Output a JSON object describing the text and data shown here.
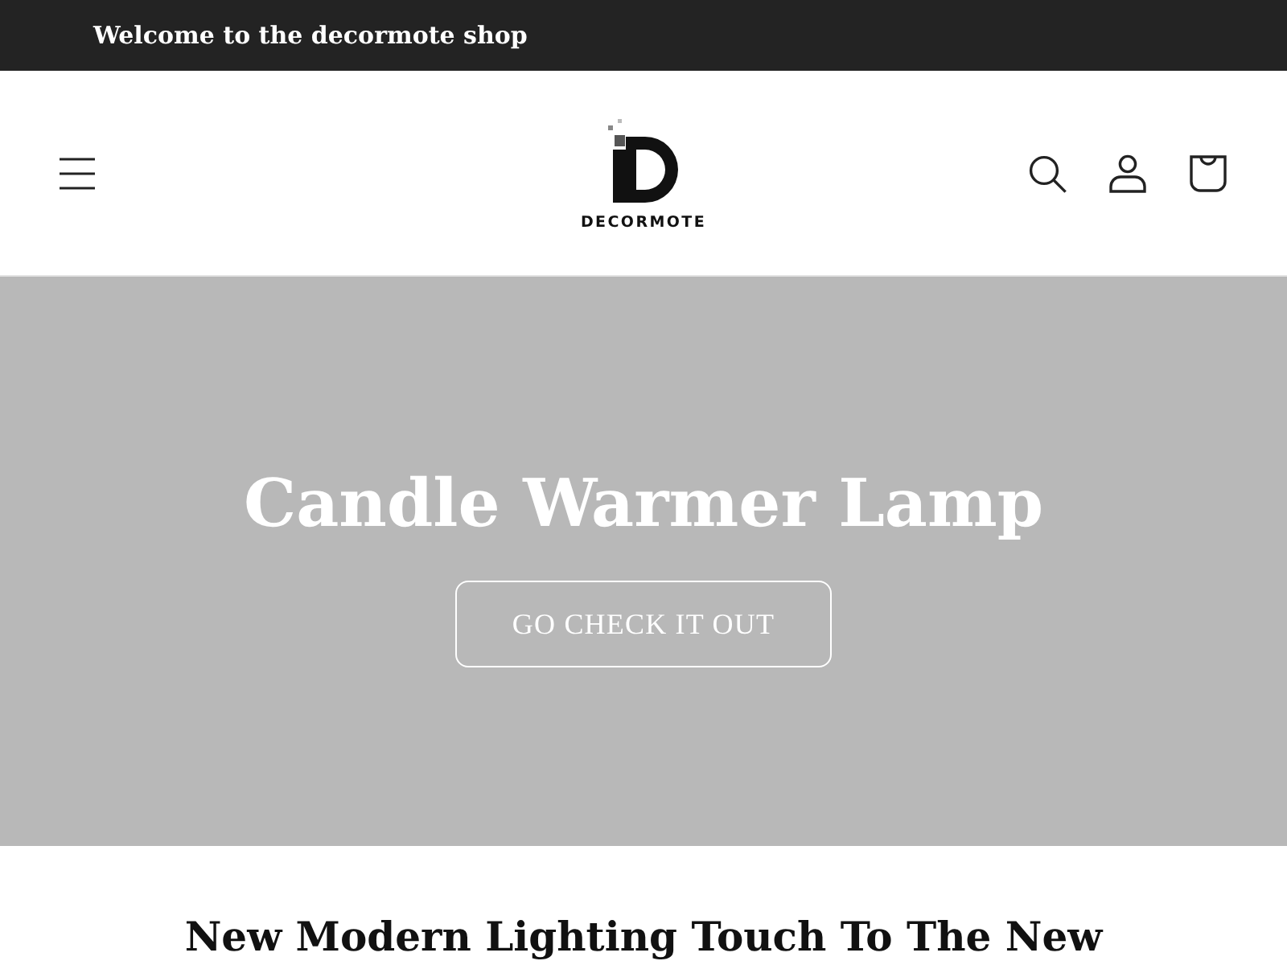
{
  "announcement_bar": {
    "text": "Welcome to the decormote shop"
  },
  "header": {
    "logo_text": "DECORMOTE"
  },
  "hero": {
    "title": "Candle Warmer Lamp",
    "button": "GO CHECK IT OUT"
  },
  "section": {
    "heading": "New Modern Lighting Touch To The New"
  }
}
